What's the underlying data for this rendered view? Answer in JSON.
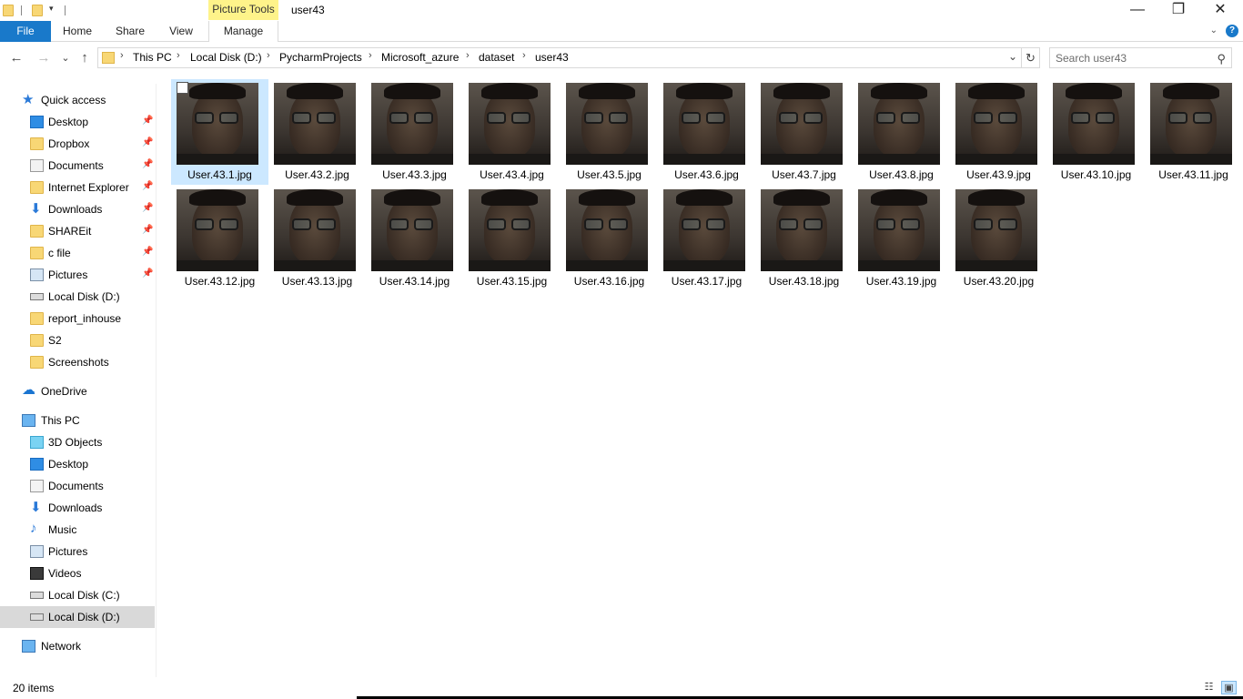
{
  "titlebar": {
    "context_tab": "Picture Tools",
    "window_title": "user43",
    "minimize": "—",
    "maximize": "❐",
    "close": "✕",
    "qa_dropdown": "▾"
  },
  "ribbon": {
    "tabs": [
      "File",
      "Home",
      "Share",
      "View",
      "Manage"
    ],
    "expand": "⌄",
    "help": "?"
  },
  "navbar": {
    "back": "←",
    "forward": "→",
    "recent": "⌄",
    "up": "↑",
    "crumbs": [
      "This PC",
      "Local Disk (D:)",
      "PycharmProjects",
      "Microsoft_azure",
      "dataset",
      "user43"
    ],
    "crumb_sep": "›",
    "dropdown": "⌄",
    "refresh": "↻",
    "search_placeholder": "Search user43",
    "search_icon": "⚲"
  },
  "nav_pane": {
    "items": [
      {
        "label": "Quick access",
        "icon": "star-icon",
        "pinned": false
      },
      {
        "label": "Desktop",
        "icon": "desktop-icon",
        "pinned": true
      },
      {
        "label": "Dropbox",
        "icon": "folder-icon",
        "pinned": true
      },
      {
        "label": "Documents",
        "icon": "documents-icon",
        "pinned": true
      },
      {
        "label": "Internet Explorer",
        "icon": "folder-icon",
        "pinned": true
      },
      {
        "label": "Downloads",
        "icon": "download-icon",
        "pinned": true
      },
      {
        "label": "SHAREit",
        "icon": "folder-icon",
        "pinned": true
      },
      {
        "label": "c file",
        "icon": "folder-icon",
        "pinned": true
      },
      {
        "label": "Pictures",
        "icon": "pictures-icon",
        "pinned": true
      },
      {
        "label": "Local Disk (D:)",
        "icon": "drive-icon",
        "pinned": false
      },
      {
        "label": "report_inhouse",
        "icon": "folder-icon",
        "pinned": false
      },
      {
        "label": "S2",
        "icon": "folder-icon",
        "pinned": false
      },
      {
        "label": "Screenshots",
        "icon": "folder-icon",
        "pinned": false
      },
      {
        "label": "OneDrive",
        "icon": "cloud-icon",
        "pinned": false
      },
      {
        "label": "This PC",
        "icon": "pc-icon",
        "pinned": false
      },
      {
        "label": "3D Objects",
        "icon": "3d-objects-icon",
        "pinned": false
      },
      {
        "label": "Desktop",
        "icon": "desktop-icon",
        "pinned": false
      },
      {
        "label": "Documents",
        "icon": "documents-icon",
        "pinned": false
      },
      {
        "label": "Downloads",
        "icon": "download-icon",
        "pinned": false
      },
      {
        "label": "Music",
        "icon": "music-icon",
        "pinned": false
      },
      {
        "label": "Pictures",
        "icon": "pictures-icon",
        "pinned": false
      },
      {
        "label": "Videos",
        "icon": "video-icon",
        "pinned": false
      },
      {
        "label": "Local Disk (C:)",
        "icon": "drive-icon",
        "pinned": false
      },
      {
        "label": "Local Disk (D:)",
        "icon": "drive-icon",
        "pinned": false,
        "selected": true
      },
      {
        "label": "Network",
        "icon": "network-icon",
        "pinned": false
      }
    ],
    "pin_glyph": "📌"
  },
  "files": [
    "User.43.1.jpg",
    "User.43.2.jpg",
    "User.43.3.jpg",
    "User.43.4.jpg",
    "User.43.5.jpg",
    "User.43.6.jpg",
    "User.43.7.jpg",
    "User.43.8.jpg",
    "User.43.9.jpg",
    "User.43.10.jpg",
    "User.43.11.jpg",
    "User.43.12.jpg",
    "User.43.13.jpg",
    "User.43.14.jpg",
    "User.43.15.jpg",
    "User.43.16.jpg",
    "User.43.17.jpg",
    "User.43.18.jpg",
    "User.43.19.jpg",
    "User.43.20.jpg"
  ],
  "status": {
    "count": "20 items",
    "details_view": "☷",
    "large_icons_view": "▣"
  },
  "colors": {
    "file_tab": "#1979ca",
    "context_tab": "#fef38a",
    "selection": "#cce8ff",
    "folder": "#f8d775"
  }
}
